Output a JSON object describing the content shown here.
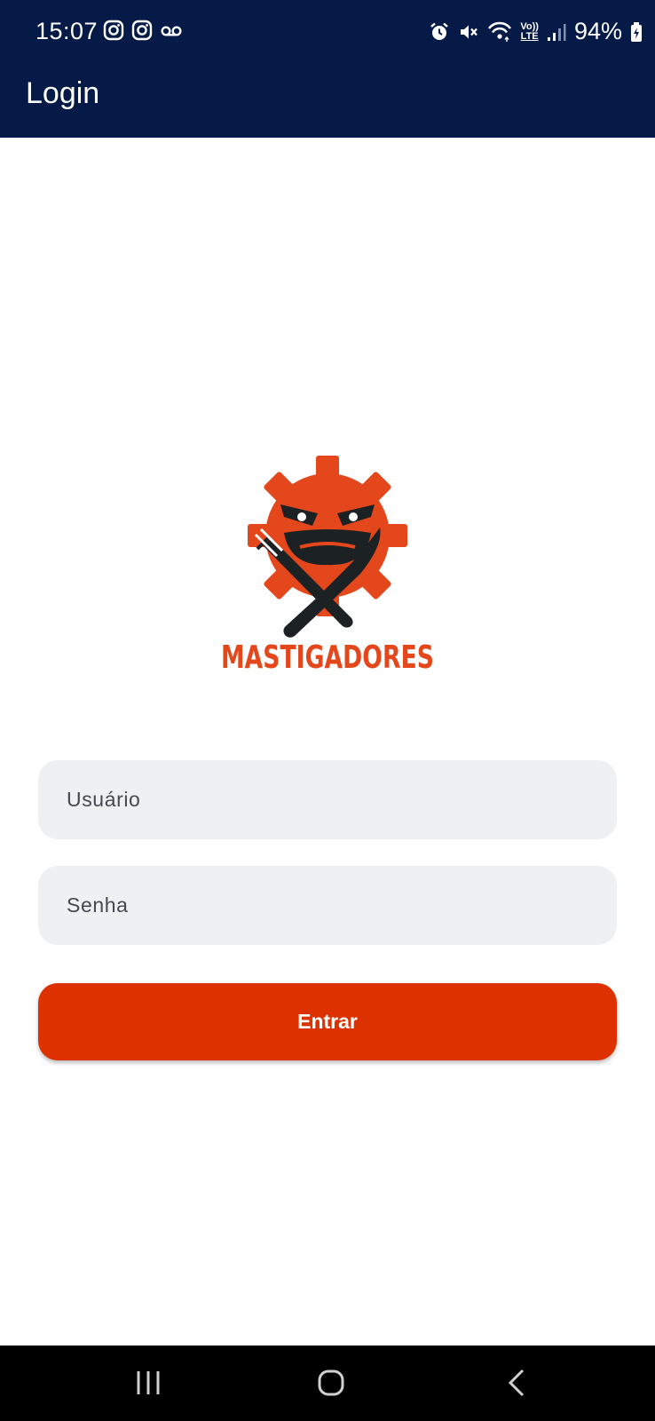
{
  "status_bar": {
    "time": "15:07",
    "battery": "94%",
    "left_icons": [
      "instagram-icon",
      "instagram-icon",
      "voicemail-icon"
    ],
    "right_icons": [
      "alarm-icon",
      "mute-icon",
      "wifi-icon",
      "volte-icon",
      "signal-icon",
      "battery-icon"
    ],
    "volte_label_top": "Vo))",
    "volte_label_bottom": "LTE"
  },
  "app_bar": {
    "title": "Login"
  },
  "logo": {
    "brand": "MASTIGADORES"
  },
  "form": {
    "username_placeholder": "Usuário",
    "password_placeholder": "Senha",
    "submit_label": "Entrar"
  },
  "nav_bar": {
    "icons": [
      "recent-apps-icon",
      "home-icon",
      "back-icon"
    ]
  },
  "colors": {
    "header_bg": "#051a47",
    "primary_button": "#dd3200",
    "field_bg": "#eff0f2",
    "logo_orange": "#e4471c",
    "logo_dark": "#1c2124"
  }
}
